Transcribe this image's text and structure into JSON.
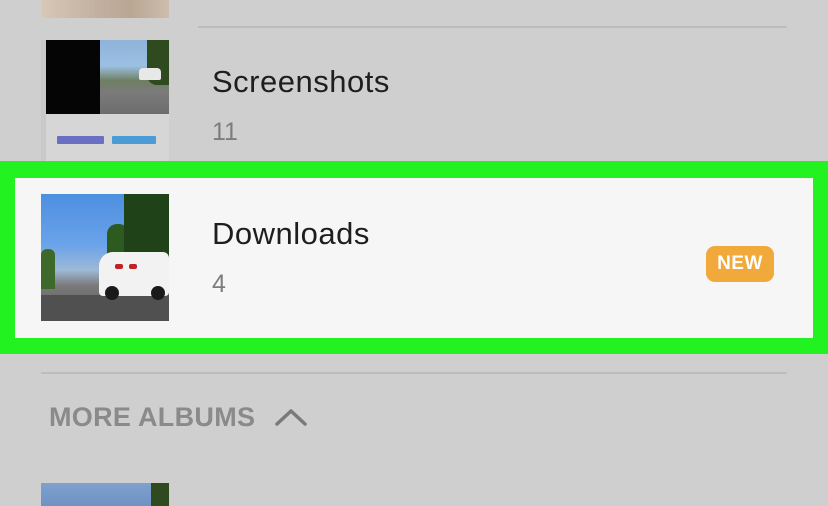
{
  "albums": [
    {
      "title": "Screenshots",
      "count": "11"
    },
    {
      "title": "Downloads",
      "count": "4",
      "badge": "NEW",
      "highlighted": true
    }
  ],
  "more_albums": {
    "label": "MORE ALBUMS",
    "icon": "chevron-up-icon"
  },
  "colors": {
    "highlight": "#23f221",
    "badge": "#f0a93a",
    "background": "#cfcfcf",
    "row_highlight_bg": "#f6f6f6"
  }
}
